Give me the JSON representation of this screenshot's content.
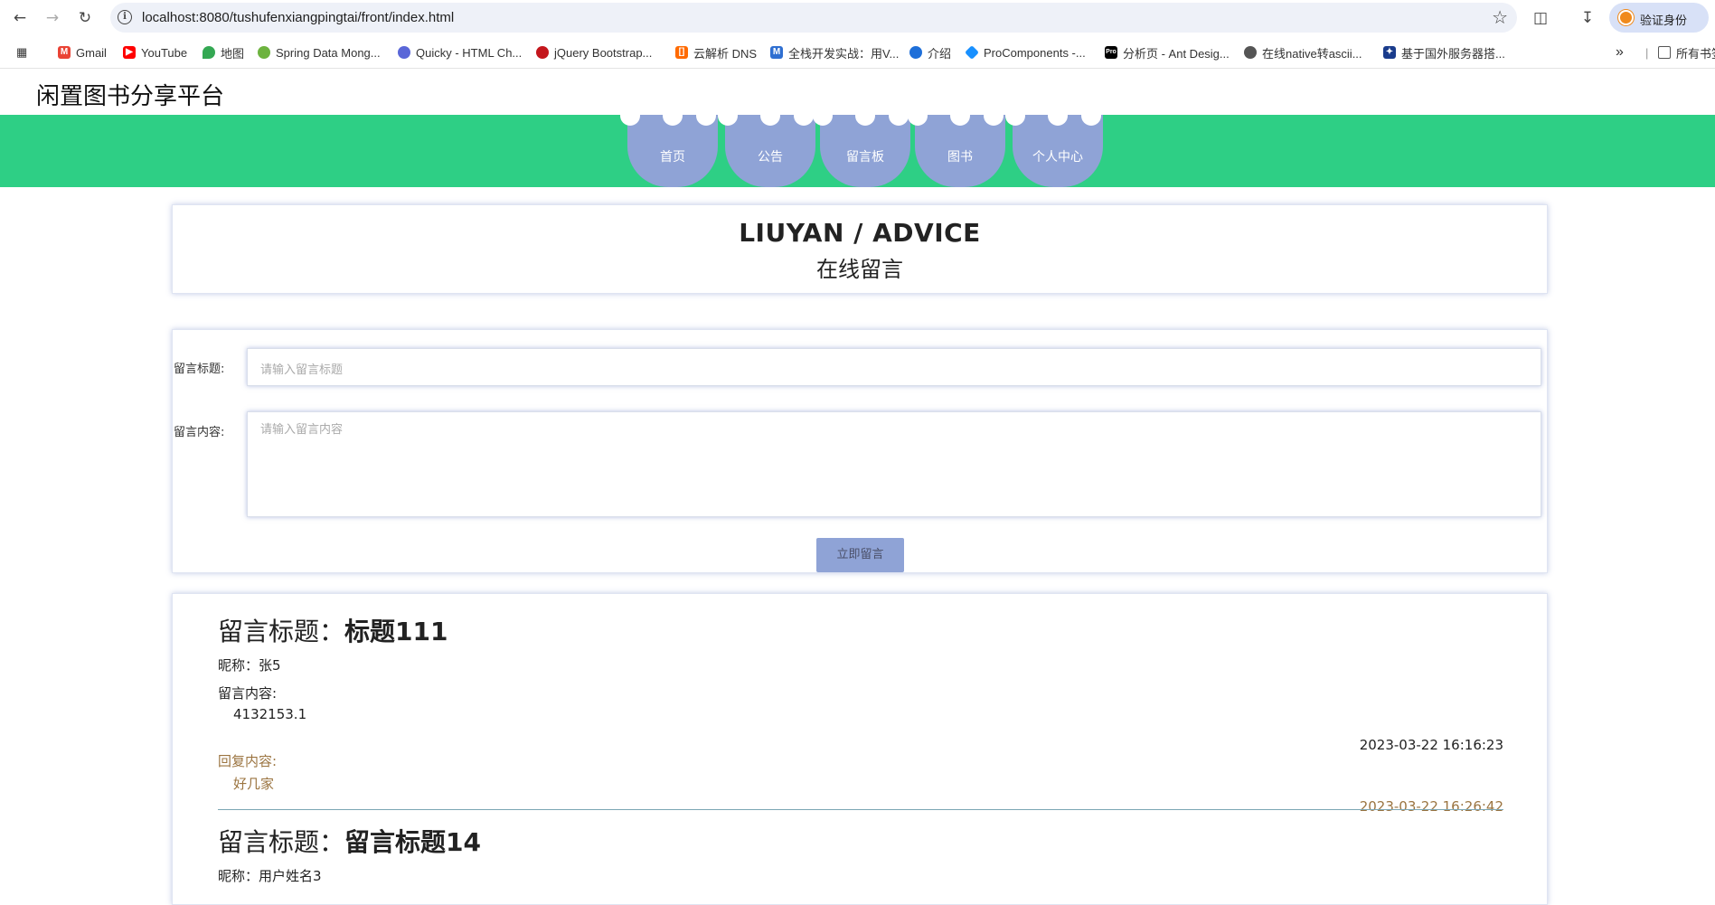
{
  "browser": {
    "url": "localhost:8080/tushufenxiangpingtai/front/index.html",
    "profile_label": "验证身份",
    "bookmarks": [
      {
        "label": "Gmail",
        "icon": "gmail-icon",
        "color": "#ea4335"
      },
      {
        "label": "YouTube",
        "icon": "youtube-icon",
        "color": "#ff0000"
      },
      {
        "label": "地图",
        "icon": "maps-icon",
        "color": "#34a853"
      },
      {
        "label": "Spring Data Mong...",
        "icon": "spring-icon",
        "color": "#6db33f"
      },
      {
        "label": "Quicky - HTML Ch...",
        "icon": "quicky-icon",
        "color": "#5a67d8"
      },
      {
        "label": "jQuery Bootstrap...",
        "icon": "jquery-icon",
        "color": "#c4161c"
      },
      {
        "label": "云解析 DNS",
        "icon": "aliyun-icon",
        "color": "#ff6a00"
      },
      {
        "label": "全栈开发实战：用V...",
        "icon": "m-icon",
        "color": "#2f6fd1"
      },
      {
        "label": "介绍",
        "icon": "globe-icon",
        "color": "#1e6fd9"
      },
      {
        "label": "ProComponents -...",
        "icon": "procomponents-icon",
        "color": "#1890ff"
      },
      {
        "label": "分析页 - Ant Desig...",
        "icon": "pro-icon",
        "color": "#000000"
      },
      {
        "label": "在线native转ascii...",
        "icon": "web-icon",
        "color": "#555555"
      },
      {
        "label": "基于国外服务器搭...",
        "icon": "site-icon",
        "color": "#1a3c8c"
      }
    ],
    "all_bookmarks_label": "所有书签"
  },
  "site": {
    "title": "闲置图书分享平台",
    "nav": [
      "首页",
      "公告",
      "留言板",
      "图书",
      "个人中心"
    ]
  },
  "header": {
    "en": "LIUYAN / ADVICE",
    "cn": "在线留言"
  },
  "form": {
    "title_label": "留言标题:",
    "title_placeholder": "请输入留言标题",
    "content_label": "留言内容:",
    "content_placeholder": "请输入留言内容",
    "submit_label": "立即留言"
  },
  "messages": [
    {
      "title_prefix": "留言标题：",
      "title": "标题111",
      "nickname_prefix": "昵称：",
      "nickname": "张5",
      "content_label": "留言内容:",
      "content": "4132153.1",
      "date": "2023-03-22 16:16:23",
      "reply_label": "回复内容:",
      "reply": "好几家",
      "reply_date": "2023-03-22 16:26:42"
    },
    {
      "title_prefix": "留言标题：",
      "title": "留言标题14",
      "nickname_prefix": "昵称：",
      "nickname": "用户姓名3"
    }
  ]
}
